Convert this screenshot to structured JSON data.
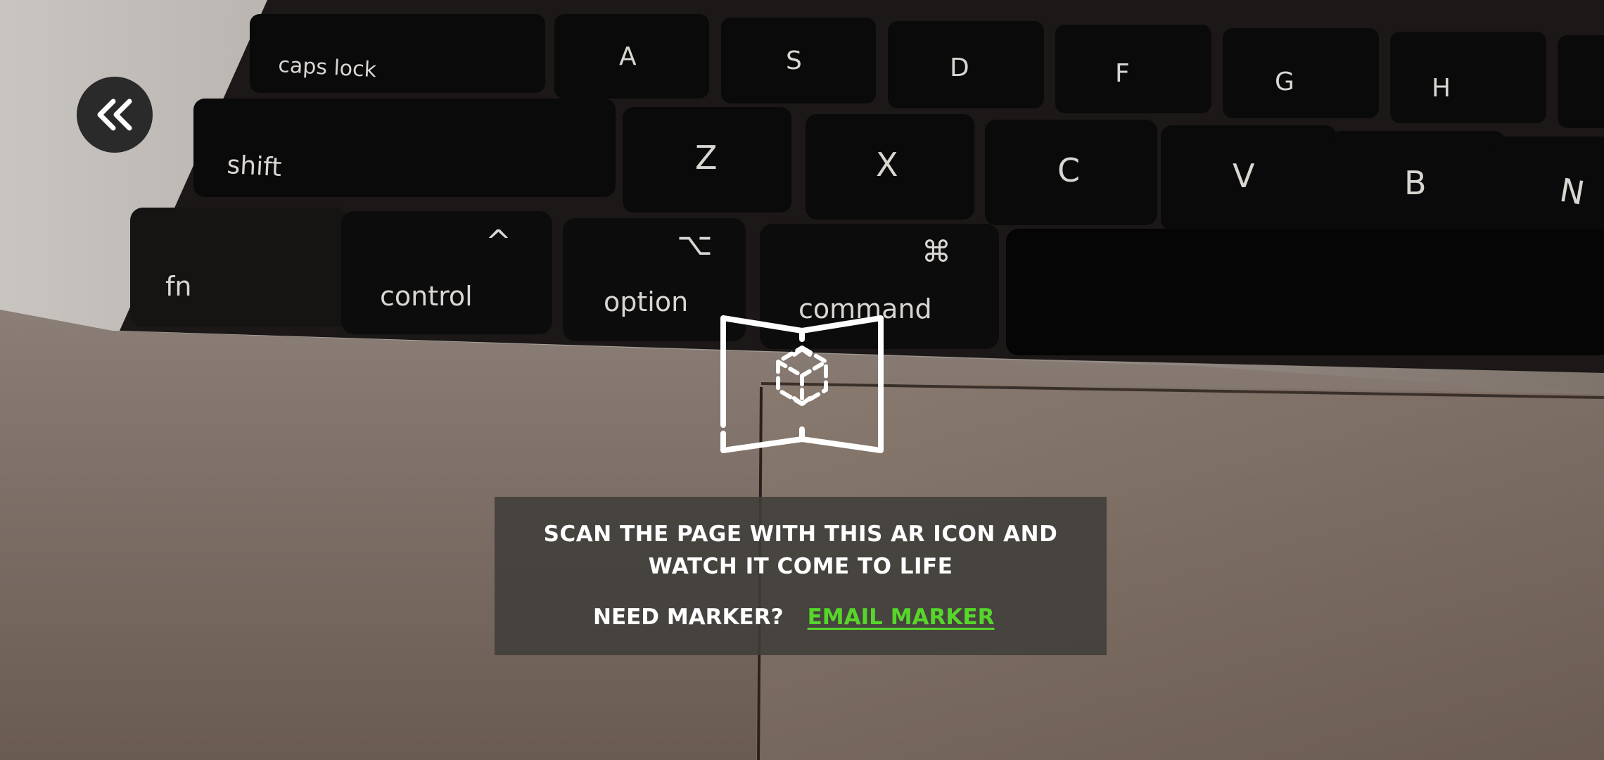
{
  "camera_feed": {
    "keys": {
      "caps_lock": "caps lock",
      "a": "A",
      "s": "S",
      "d": "D",
      "f": "F",
      "g": "G",
      "h": "H",
      "shift": "shift",
      "z": "Z",
      "x": "X",
      "c": "C",
      "v": "V",
      "b": "B",
      "n": "N",
      "fn": "fn",
      "control": "control",
      "control_symbol": "^",
      "option": "option",
      "option_symbol": "⌥",
      "command": "command",
      "command_symbol": "⌘"
    }
  },
  "back_button": {
    "icon": "double-chevron-left-icon"
  },
  "ar_icon": {
    "icon": "ar-book-cube-icon"
  },
  "instruction": {
    "line1": "SCAN THE PAGE WITH THIS AR ICON AND",
    "line2": "WATCH IT COME TO LIFE",
    "need_marker": "NEED MARKER?",
    "email_marker": "EMAIL MARKER"
  },
  "colors": {
    "link": "#56d62a",
    "panel": "#403d3a",
    "button": "#2b2a2a"
  }
}
